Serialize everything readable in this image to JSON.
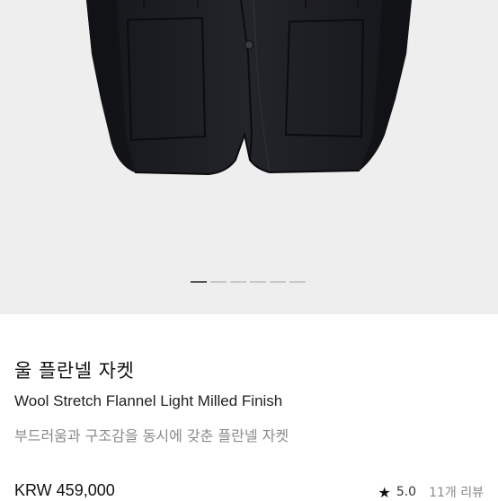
{
  "gallery": {
    "image_alt": "wool stretch flannel jacket product photo",
    "slide_count": 6,
    "active_slide": 1
  },
  "product": {
    "name_ko": "울 플란넬 자켓",
    "name_en": "Wool Stretch Flannel Light Milled Finish",
    "description": "부드러움과 구조감을 동시에 갖춘 플란넬 자켓",
    "price": "KRW 459,000",
    "rating": "5.0",
    "review_count": "11개 리뷰"
  },
  "icons": {
    "rating_star": "star-icon"
  },
  "colors": {
    "hero_background": "#eeeeee",
    "jacket": "#1c1d21",
    "active_dot": "#555555",
    "inactive_dot": "#c8c8c8",
    "muted_text": "#8a8a8a"
  }
}
